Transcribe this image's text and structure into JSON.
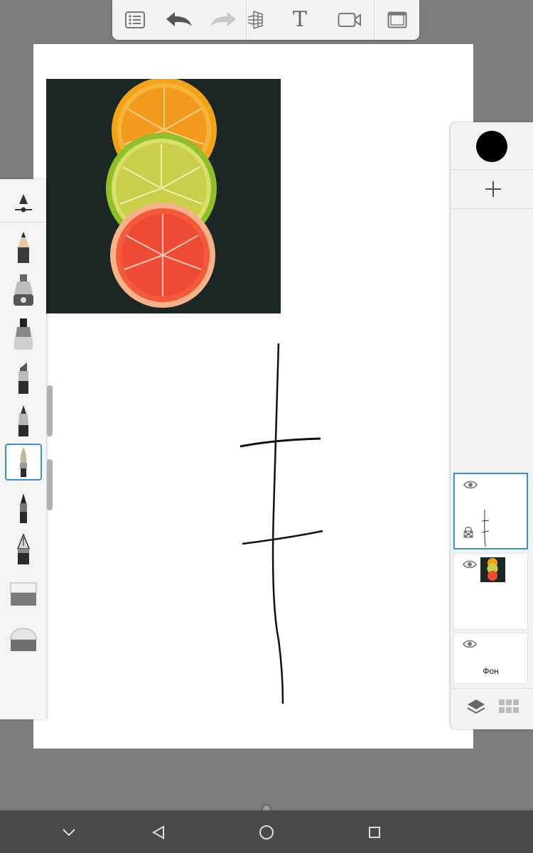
{
  "app": {
    "colors": {
      "accent": "#3b8fd9",
      "toolbar_bg": "#f2f2f2",
      "backdrop": "#7d7d7d",
      "navbar": "#4a4a4a",
      "current_color": "#000000"
    }
  },
  "toolbar": {
    "items": [
      {
        "name": "list-button",
        "icon": "list-icon"
      },
      {
        "name": "undo-button",
        "icon": "undo-arrow-icon"
      },
      {
        "name": "redo-button",
        "icon": "redo-arrow-icon",
        "disabled": true
      },
      {
        "name": "perspective-button",
        "icon": "perspective-grid-icon"
      },
      {
        "name": "text-button",
        "icon": "text-icon",
        "label": "T"
      },
      {
        "name": "video-button",
        "icon": "video-camera-icon"
      },
      {
        "name": "fullscreen-button",
        "icon": "fullscreen-frame-icon"
      }
    ]
  },
  "brushes": {
    "items": [
      "brush-settings-icon",
      "pencil-icon",
      "airbrush-icon",
      "marker-icon",
      "chisel-marker-icon",
      "ballpoint-pen-icon",
      "paintbrush-icon",
      "fineliner-icon",
      "fountain-pen-icon",
      "soft-eraser-icon",
      "hard-eraser-icon"
    ],
    "selected": "paintbrush-icon"
  },
  "layers": {
    "items": [
      {
        "id": "sketch-layer",
        "visible": true,
        "active": true,
        "locked_alpha": true
      },
      {
        "id": "photo-layer",
        "visible": true,
        "active": false
      },
      {
        "id": "background-layer",
        "visible": true,
        "active": false,
        "label": "Фон"
      }
    ],
    "footer_icons": [
      "layers-stack-icon",
      "grid-icon"
    ]
  },
  "navbar": {
    "icons": [
      "chevron-down-icon",
      "back-icon",
      "home-icon",
      "recents-icon"
    ]
  }
}
